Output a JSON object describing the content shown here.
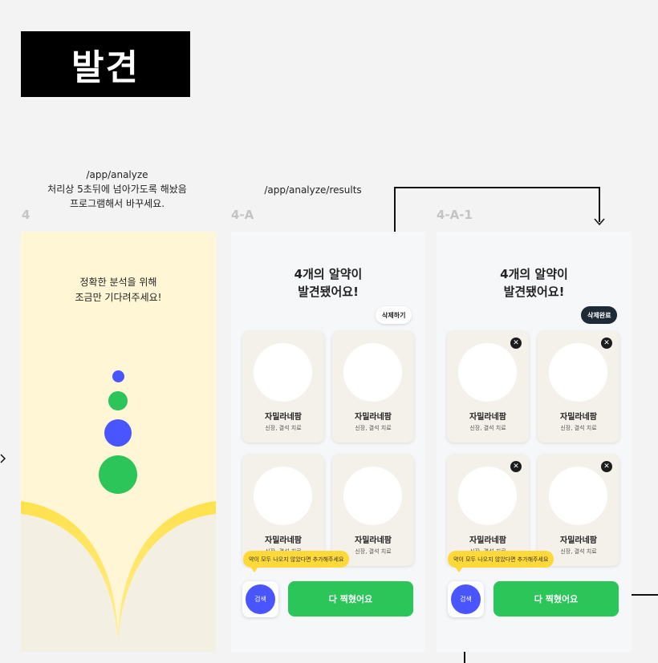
{
  "page_title": "발견",
  "notes": {
    "analyze_route": "/app/analyze",
    "analyze_line1": "처리상 5초뒤에 넘아가도록 해놨음",
    "analyze_line2": "프로그램해서 바꾸세요.",
    "results_route": "/app/analyze/results"
  },
  "screens": {
    "s1": {
      "label": "4",
      "msg_line1": "정확한 분석을 위해",
      "msg_line2": "조금만 기다려주세요!"
    },
    "s2": {
      "label": "4-A",
      "heading_line1": "4개의 알약이",
      "heading_line2": "발견됐어요!",
      "pill": "삭제하기",
      "tooltip": "약이 모두 나오지 않았다면 추가해주세요",
      "search_label": "검색",
      "done_label": "다 찍혔어요"
    },
    "s3": {
      "label": "4-A-1",
      "heading_line1": "4개의 알약이",
      "heading_line2": "발견됐어요!",
      "pill": "삭제완료",
      "tooltip": "약이 모두 나오지 않았다면 추가해주세요",
      "search_label": "검색",
      "done_label": "다 찍혔어요"
    }
  },
  "pills": [
    {
      "name": "자밀라네팜",
      "desc": "신장, 결석 치료"
    },
    {
      "name": "자밀라네팜",
      "desc": "신장, 결석 치료"
    },
    {
      "name": "자밀라네팜",
      "desc": "신장, 결석 치료"
    },
    {
      "name": "자밀라네팜",
      "desc": "신장, 결석 치료"
    }
  ],
  "colors": {
    "accent_blue": "#4955ff",
    "accent_green": "#2cc55a",
    "tooltip_yellow": "#ffd93a",
    "loading_bg": "#fff6d6"
  },
  "icons": {
    "delete": "close-icon",
    "arrow": "arrow-down-icon"
  }
}
